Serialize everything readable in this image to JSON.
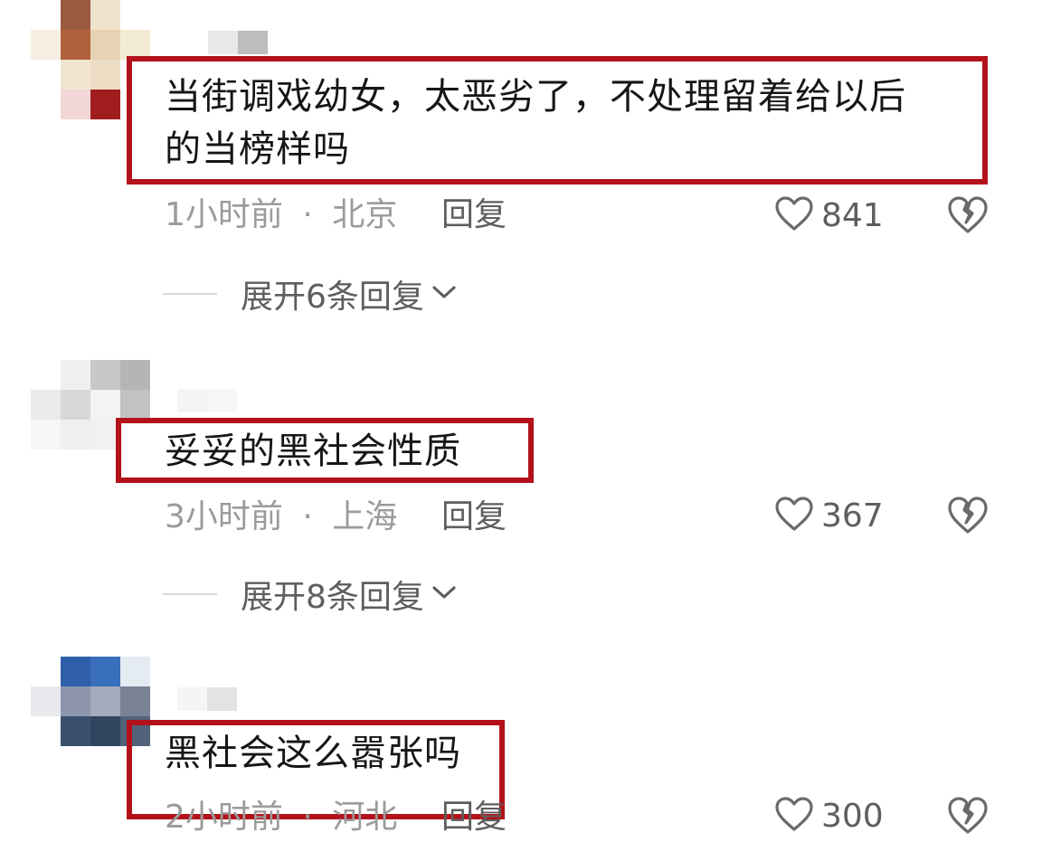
{
  "comments": [
    {
      "text": "当街调戏幼女，太恶劣了，不处理留着给以后\n的当榜样吗",
      "time": "1小时前",
      "location": "北京",
      "reply_label": "回复",
      "likes": "841",
      "expand_label": "展开6条回复"
    },
    {
      "text": "妥妥的黑社会性质",
      "time": "3小时前",
      "location": "上海",
      "reply_label": "回复",
      "likes": "367",
      "expand_label": "展开8条回复"
    },
    {
      "text": "黑社会这么嚣张吗",
      "time": "2小时前",
      "location": "河北",
      "reply_label": "回复",
      "likes": "300"
    }
  ],
  "meta_separator": "·",
  "icons": {
    "like": "heart-outline-icon",
    "dislike": "broken-heart-icon",
    "expand": "chevron-down-icon"
  },
  "colors": {
    "highlight_box": "#b3121a",
    "text": "#161616",
    "meta": "#9b9b9b"
  }
}
